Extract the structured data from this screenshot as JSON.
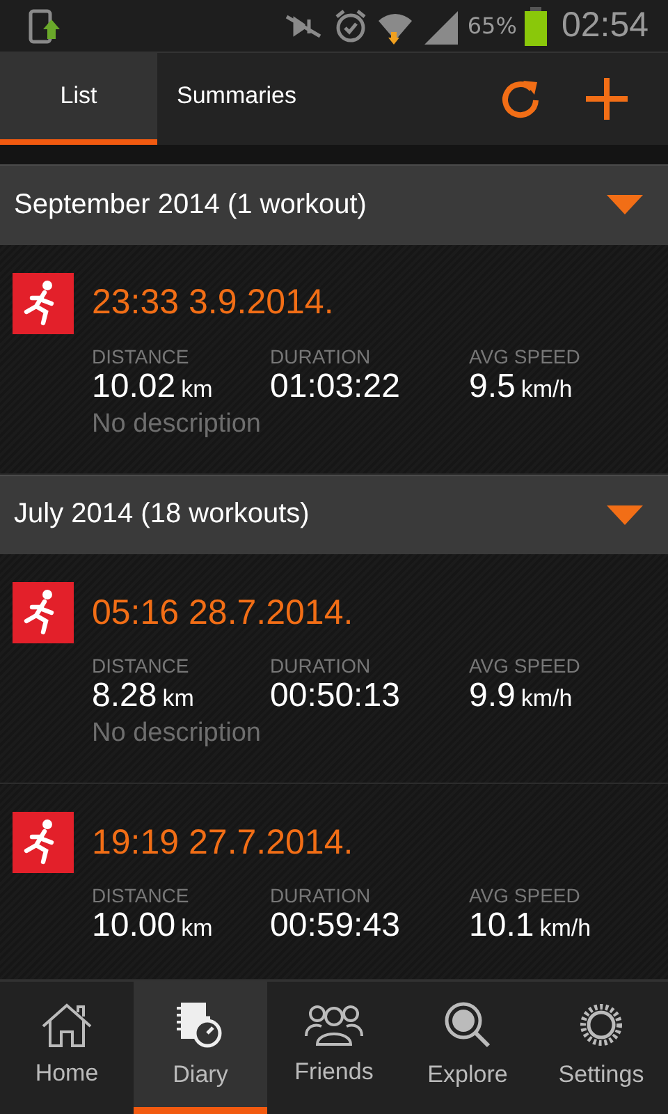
{
  "status_bar": {
    "battery_text": "65%",
    "time": "02:54"
  },
  "tabs": [
    {
      "label": "List",
      "selected": true
    },
    {
      "label": "Summaries",
      "selected": false
    }
  ],
  "groups": [
    {
      "title": "September 2014 (1 workout)",
      "expanded": true,
      "workouts": [
        {
          "time": "23:33 3.9.2014.",
          "labels": {
            "distance": "DISTANCE",
            "duration": "DURATION",
            "speed": "AVG SPEED"
          },
          "distance": "10.02",
          "distance_unit": "km",
          "duration": "01:03:22",
          "speed": "9.5",
          "speed_unit": "km/h",
          "description": "No description"
        }
      ]
    },
    {
      "title": "July 2014 (18 workouts)",
      "expanded": true,
      "workouts": [
        {
          "time": "05:16 28.7.2014.",
          "labels": {
            "distance": "DISTANCE",
            "duration": "DURATION",
            "speed": "AVG SPEED"
          },
          "distance": "8.28",
          "distance_unit": "km",
          "duration": "00:50:13",
          "speed": "9.9",
          "speed_unit": "km/h",
          "description": "No description"
        },
        {
          "time": "19:19 27.7.2014.",
          "labels": {
            "distance": "DISTANCE",
            "duration": "DURATION",
            "speed": "AVG SPEED"
          },
          "distance": "10.00",
          "distance_unit": "km",
          "duration": "00:59:43",
          "speed": "10.1",
          "speed_unit": "km/h"
        }
      ]
    }
  ],
  "nav": [
    {
      "label": "Home",
      "kind": "home",
      "selected": false
    },
    {
      "label": "Diary",
      "kind": "diary",
      "selected": true
    },
    {
      "label": "Friends",
      "kind": "friends",
      "selected": false
    },
    {
      "label": "Explore",
      "kind": "explore",
      "selected": false
    },
    {
      "label": "Settings",
      "kind": "settings",
      "selected": false
    }
  ]
}
